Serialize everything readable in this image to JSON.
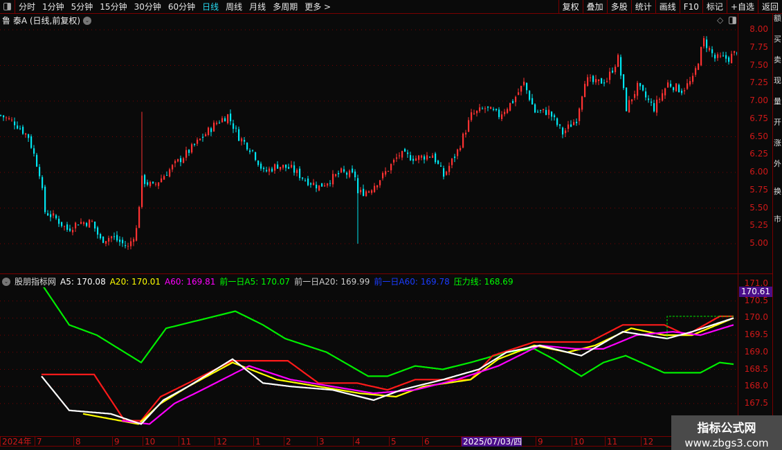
{
  "toolbar": {
    "periods": [
      "分时",
      "1分钟",
      "5分钟",
      "15分钟",
      "30分钟",
      "60分钟",
      "日线",
      "周线",
      "月线",
      "多周期",
      "更多 >"
    ],
    "active": "日线",
    "buttons": [
      "复权",
      "叠加",
      "多股",
      "统计",
      "画线",
      "F10",
      "标记",
      "+自选",
      "返回"
    ]
  },
  "title": "鲁 泰A (日线,前复权)",
  "indicator": {
    "name": "股朋指标网",
    "items": [
      {
        "label": "A5: 170.08",
        "color": "#ffffff"
      },
      {
        "label": "A20: 170.01",
        "color": "#ffff00"
      },
      {
        "label": "A60: 169.81",
        "color": "#ff00ff"
      },
      {
        "label": "前一日A5: 170.07",
        "color": "#00ff00"
      },
      {
        "label": "前一日A20: 169.99",
        "color": "#cccccc"
      },
      {
        "label": "前一日A60: 169.78",
        "color": "#1a3cff"
      },
      {
        "label": "压力线: 168.69",
        "color": "#00ff00"
      }
    ],
    "current": "170.61"
  },
  "price_axis": [
    "8.00",
    "7.75",
    "7.50",
    "7.25",
    "7.00",
    "6.75",
    "6.50",
    "6.25",
    "6.00",
    "5.75",
    "5.50",
    "5.25",
    "5.00"
  ],
  "ind_axis": [
    "171.0",
    "170.5",
    "170.0",
    "169.5",
    "169.0",
    "168.5",
    "168.0",
    "167.5"
  ],
  "time_axis": [
    {
      "t": "2024年",
      "d": 0
    },
    {
      "t": "7",
      "d": 12
    },
    {
      "t": "8",
      "d": 26
    },
    {
      "t": "9",
      "d": 40
    },
    {
      "t": "10",
      "d": 51
    },
    {
      "t": "11",
      "d": 64
    },
    {
      "t": "12",
      "d": 77
    },
    {
      "t": "1",
      "d": 91
    },
    {
      "t": "2",
      "d": 102
    },
    {
      "t": "3",
      "d": 114
    },
    {
      "t": "4",
      "d": 127
    },
    {
      "t": "5",
      "d": 140
    },
    {
      "t": "6",
      "d": 152
    },
    {
      "t": "2025/07/03/四",
      "d": 166,
      "hl": true
    },
    {
      "t": "9",
      "d": 193
    },
    {
      "t": "10",
      "d": 206
    },
    {
      "t": "11",
      "d": 218
    },
    {
      "t": "12",
      "d": 231
    }
  ],
  "watermark": {
    "title": "指标公式网",
    "url": "www.zbgs3.com"
  },
  "side_chars": [
    "额",
    "买",
    "卖",
    "现",
    "量",
    "开",
    "涨",
    "外",
    "换",
    "市"
  ],
  "colors": {
    "up": "#ff3232",
    "down": "#00e5f0",
    "grid": "#7a0000",
    "a5": "#ffffff",
    "a20": "#ffff00",
    "a60": "#ff00ff",
    "pressure": "#00ee00",
    "prev": "#ff1a1a"
  },
  "chart_data": [
    {
      "type": "candlestick",
      "title": "鲁泰A 日线",
      "ylim": [
        4.8,
        8.1
      ],
      "closes": [
        [
          0,
          6.8
        ],
        [
          5,
          6.7
        ],
        [
          10,
          6.5
        ],
        [
          14,
          6.0
        ],
        [
          16,
          5.45
        ],
        [
          20,
          5.35
        ],
        [
          24,
          5.2
        ],
        [
          28,
          5.3
        ],
        [
          33,
          5.3
        ],
        [
          36,
          5.05
        ],
        [
          40,
          5.1
        ],
        [
          46,
          4.95
        ],
        [
          49,
          5.2
        ],
        [
          51,
          5.9
        ],
        [
          55,
          5.8
        ],
        [
          60,
          6.0
        ],
        [
          68,
          6.3
        ],
        [
          73,
          6.5
        ],
        [
          78,
          6.7
        ],
        [
          82,
          6.8
        ],
        [
          86,
          6.5
        ],
        [
          91,
          6.3
        ],
        [
          95,
          6.0
        ],
        [
          100,
          6.1
        ],
        [
          105,
          6.05
        ],
        [
          110,
          5.9
        ],
        [
          115,
          5.8
        ],
        [
          123,
          6.0
        ],
        [
          128,
          5.95
        ],
        [
          129,
          5.7
        ],
        [
          133,
          5.75
        ],
        [
          138,
          5.95
        ],
        [
          144,
          6.25
        ],
        [
          150,
          6.2
        ],
        [
          156,
          6.25
        ],
        [
          160,
          5.95
        ],
        [
          165,
          6.3
        ],
        [
          170,
          6.8
        ],
        [
          175,
          6.9
        ],
        [
          180,
          6.8
        ],
        [
          185,
          7.0
        ],
        [
          189,
          7.25
        ],
        [
          193,
          6.85
        ],
        [
          198,
          6.85
        ],
        [
          203,
          6.55
        ],
        [
          208,
          6.75
        ],
        [
          211,
          7.3
        ],
        [
          215,
          7.25
        ],
        [
          219,
          7.3
        ],
        [
          223,
          7.6
        ],
        [
          226,
          6.9
        ],
        [
          230,
          7.2
        ],
        [
          236,
          6.9
        ],
        [
          241,
          7.25
        ],
        [
          246,
          7.15
        ],
        [
          250,
          7.3
        ],
        [
          254,
          7.85
        ],
        [
          258,
          7.6
        ],
        [
          263,
          7.6
        ],
        [
          266,
          7.7
        ]
      ]
    },
    {
      "type": "line",
      "ylim": [
        166.8,
        171.2
      ],
      "series": [
        {
          "name": "压力线",
          "color": "#00ee00",
          "points": [
            [
              15,
              171.0
            ],
            [
              25,
              169.8
            ],
            [
              35,
              169.5
            ],
            [
              51,
              168.7
            ],
            [
              60,
              169.7
            ],
            [
              75,
              170.0
            ],
            [
              85,
              170.2
            ],
            [
              95,
              169.8
            ],
            [
              103,
              169.4
            ],
            [
              118,
              169.0
            ],
            [
              133,
              168.3
            ],
            [
              140,
              168.3
            ],
            [
              150,
              168.6
            ],
            [
              160,
              168.5
            ],
            [
              170,
              168.7
            ],
            [
              183,
              169.0
            ],
            [
              193,
              169.1
            ],
            [
              200,
              168.8
            ],
            [
              210,
              168.3
            ],
            [
              218,
              168.7
            ],
            [
              226,
              168.9
            ],
            [
              240,
              168.4
            ],
            [
              253,
              168.4
            ],
            [
              260,
              168.7
            ],
            [
              265,
              168.65
            ]
          ]
        },
        {
          "name": "前一日",
          "color": "#ff1a1a",
          "points": [
            [
              15,
              168.35
            ],
            [
              34,
              168.35
            ],
            [
              45,
              167.0
            ],
            [
              51,
              167.0
            ],
            [
              58,
              167.7
            ],
            [
              68,
              168.1
            ],
            [
              84,
              168.75
            ],
            [
              104,
              168.75
            ],
            [
              115,
              168.1
            ],
            [
              129,
              168.1
            ],
            [
              140,
              167.9
            ],
            [
              150,
              168.2
            ],
            [
              170,
              168.2
            ],
            [
              178,
              168.9
            ],
            [
              193,
              169.3
            ],
            [
              213,
              169.3
            ],
            [
              225,
              169.8
            ],
            [
              240,
              169.8
            ],
            [
              248,
              169.5
            ],
            [
              260,
              170.05
            ],
            [
              265,
              170.05
            ]
          ]
        },
        {
          "name": "A20",
          "color": "#ffff00",
          "points": [
            [
              30,
              167.2
            ],
            [
              50,
              166.9
            ],
            [
              58,
              167.5
            ],
            [
              68,
              168.0
            ],
            [
              84,
              168.7
            ],
            [
              100,
              168.2
            ],
            [
              115,
              168.0
            ],
            [
              130,
              167.8
            ],
            [
              143,
              167.7
            ],
            [
              153,
              168.0
            ],
            [
              170,
              168.2
            ],
            [
              180,
              168.8
            ],
            [
              193,
              169.2
            ],
            [
              205,
              169.0
            ],
            [
              215,
              169.2
            ],
            [
              228,
              169.7
            ],
            [
              240,
              169.5
            ],
            [
              250,
              169.5
            ],
            [
              265,
              170.0
            ]
          ]
        },
        {
          "name": "A60",
          "color": "#ff00ff",
          "points": [
            [
              44,
              167.0
            ],
            [
              54,
              166.9
            ],
            [
              63,
              167.5
            ],
            [
              73,
              167.9
            ],
            [
              90,
              168.6
            ],
            [
              105,
              168.2
            ],
            [
              120,
              168.0
            ],
            [
              135,
              167.8
            ],
            [
              150,
              167.9
            ],
            [
              165,
              168.2
            ],
            [
              180,
              168.6
            ],
            [
              195,
              169.2
            ],
            [
              208,
              169.1
            ],
            [
              218,
              169.1
            ],
            [
              230,
              169.5
            ],
            [
              243,
              169.6
            ],
            [
              253,
              169.5
            ],
            [
              265,
              169.8
            ]
          ]
        },
        {
          "name": "A5",
          "color": "#ffffff",
          "points": [
            [
              15,
              168.3
            ],
            [
              25,
              167.3
            ],
            [
              40,
              167.2
            ],
            [
              51,
              166.9
            ],
            [
              59,
              167.6
            ],
            [
              68,
              168.0
            ],
            [
              84,
              168.8
            ],
            [
              95,
              168.1
            ],
            [
              105,
              168.0
            ],
            [
              120,
              167.9
            ],
            [
              135,
              167.6
            ],
            [
              145,
              167.9
            ],
            [
              160,
              168.2
            ],
            [
              173,
              168.5
            ],
            [
              183,
              169.0
            ],
            [
              195,
              169.2
            ],
            [
              210,
              168.9
            ],
            [
              225,
              169.6
            ],
            [
              241,
              169.4
            ],
            [
              250,
              169.6
            ],
            [
              265,
              170.0
            ]
          ]
        },
        {
          "name": "前一日A5",
          "color": "#00ee00",
          "dashed": true,
          "points": [
            [
              241,
              169.4
            ],
            [
              241,
              170.05
            ],
            [
              265,
              170.05
            ]
          ]
        }
      ]
    }
  ]
}
